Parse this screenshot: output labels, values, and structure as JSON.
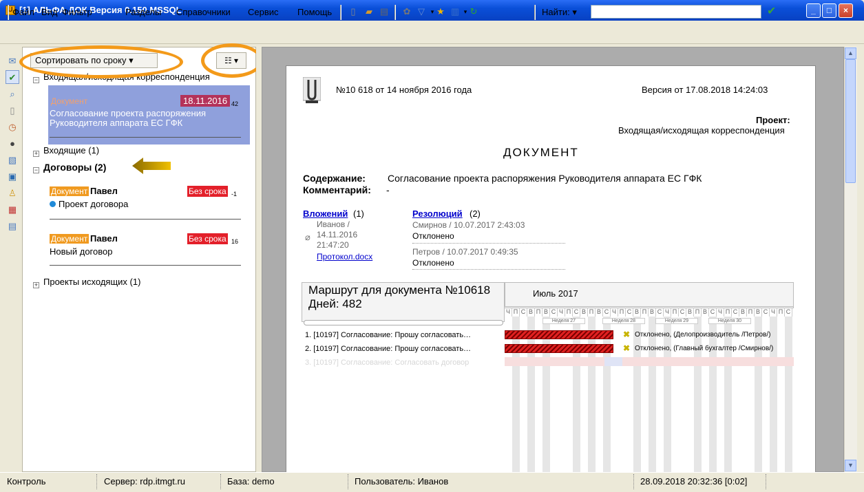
{
  "window": {
    "title": "[1] АЛЬФА ДОК Версия 0.150 MSSQL",
    "app_icon": "U",
    "min_label": "_",
    "max_label": "□",
    "close_label": "×"
  },
  "menu": {
    "items": [
      "Файл",
      "Вид",
      "Фильтр",
      "Разделы",
      "Справочники",
      "Сервис",
      "Помощь"
    ],
    "find_label": "Найти: ▾",
    "find_value": "",
    "find_ok": "✔"
  },
  "left": {
    "sort_label": "Сортировать по сроку ▾",
    "view_label": "☷ ▾",
    "groups": {
      "incoming_outgoing": "Входящая/исходящая корреспонденция",
      "incoming": "Входящие (1)",
      "contracts": "Договоры (2)",
      "outgoing_projects": "Проекты исходящих (1)"
    },
    "selected_card": {
      "badge": "Документ",
      "date": "18.11.2016",
      "count": "42",
      "text1": "Согласование проекта распоряжения",
      "text2": "Руководителя аппарата ЕС ГФК"
    },
    "card2": {
      "badge": "Документ",
      "author": "Павел",
      "term": "Без срока",
      "count": "-1",
      "text": "Проект договора"
    },
    "card3": {
      "badge": "Документ",
      "author": "Павел",
      "term": "Без срока",
      "count": "16",
      "text": "Новый договор"
    }
  },
  "doc": {
    "number": "№10 618 от 14 ноября 2016 года",
    "version": "Версия от 17.08.2018 14:24:03",
    "project_label": "Проект:",
    "project_value": "Входящая/исходящая корреспонденция",
    "heading": "ДОКУМЕНТ",
    "content_label": "Содержание:",
    "content_value": "Согласование проекта распоряжения Руководителя аппарата ЕС ГФК",
    "comment_label": "Комментарий:",
    "comment_value": "-",
    "attachments": {
      "label": "Вложений",
      "count": "(1)",
      "author": "Иванов /",
      "date": "14.11.2016",
      "time": "21:47:20",
      "file": "Протокол.docx"
    },
    "resolutions": {
      "label": "Резолюций",
      "count": "(2)",
      "r1_meta": "Смирнов / 10.07.2017 2:43:03",
      "r1_status": "Отклонено",
      "r2_meta": "Петров / 10.07.2017 0:49:35",
      "r2_status": "Отклонено"
    }
  },
  "gantt": {
    "route_title": "Маршрут для документа №10618",
    "days_label": "Дней: 482",
    "month": "Июль 2017",
    "day_letters": [
      "Ч",
      "П",
      "С",
      "В",
      "П",
      "В",
      "С",
      "Ч",
      "П",
      "С",
      "В",
      "П",
      "В",
      "С",
      "Ч",
      "П",
      "С",
      "В",
      "П",
      "В",
      "С",
      "Ч",
      "П",
      "С",
      "В",
      "П",
      "В",
      "С",
      "Ч",
      "П",
      "С",
      "В",
      "П",
      "В",
      "С",
      "Ч",
      "П",
      "С"
    ],
    "weeks": [
      "Неделя 27",
      "Неделя 28",
      "Неделя 29",
      "Неделя 30"
    ],
    "tasks": [
      {
        "label": "1. [10197] Согласование: Прошу согласовать…",
        "status": "Отклонено, (Делопроизводитель /Петров/)"
      },
      {
        "label": "2. [10197] Согласование: Прошу согласовать…",
        "status": "Отклонено, (Главный бухгалтер /Смирнов/)"
      },
      {
        "label": "3. [10197] Согласование: Согласовать договор",
        "status": ""
      }
    ]
  },
  "status": {
    "control": "Контроль",
    "server": "Сервер: rdp.itmgt.ru",
    "db": "База: demo",
    "user": "Пользователь: Иванов",
    "datetime": "28.09.2018 20:32:36 [0:02]"
  },
  "colors": {
    "highlight_orange": "#f39a1a",
    "selected_card": "#8fa0dc",
    "date_badge": "#b4325a",
    "term_badge": "#e3202a",
    "arrow": "#d8a300"
  }
}
